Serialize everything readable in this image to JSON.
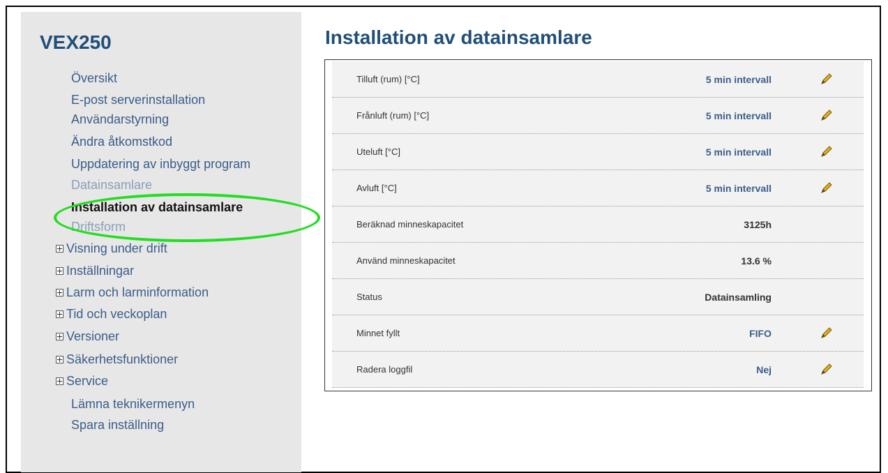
{
  "app": {
    "title": "VEX250"
  },
  "menu": {
    "items": [
      {
        "label": "Översikt"
      },
      {
        "label": "E-post serverinstallation"
      },
      {
        "label": "Användarstyrning"
      },
      {
        "label": "Ändra åtkomstkod"
      },
      {
        "label": "Uppdatering av inbyggt program"
      },
      {
        "label": "Datainsamlare"
      },
      {
        "label": "Installation av datainsamlare"
      },
      {
        "label": "Driftsform"
      },
      {
        "label": "Visning under drift"
      },
      {
        "label": "Inställningar"
      },
      {
        "label": "Larm och larminformation"
      },
      {
        "label": "Tid och veckoplan"
      },
      {
        "label": "Versioner"
      },
      {
        "label": "Säkerhetsfunktioner"
      },
      {
        "label": "Service"
      },
      {
        "label": "Lämna teknikermenyn"
      },
      {
        "label": "Spara inställning"
      }
    ],
    "active_item": "Installation av datainsamlare",
    "highlight_color": "#22dd22"
  },
  "page": {
    "title": "Installation av datainsamlare"
  },
  "settings": {
    "rows": [
      {
        "label": "Tilluft (rum) [°C]",
        "value": "5 min intervall",
        "editable": true
      },
      {
        "label": "Frånluft (rum) [°C]",
        "value": "5 min intervall",
        "editable": true
      },
      {
        "label": "Uteluft [°C]",
        "value": "5 min intervall",
        "editable": true
      },
      {
        "label": "Avluft [°C]",
        "value": "5 min intervall",
        "editable": true
      },
      {
        "label": "Beräknad minneskapacitet",
        "value": "3125h",
        "editable": false
      },
      {
        "label": "Använd minneskapacitet",
        "value": "13.6 %",
        "editable": false
      },
      {
        "label": "Status",
        "value": "Datainsamling",
        "editable": false
      },
      {
        "label": "Minnet fyllt",
        "value": "FIFO",
        "editable": true
      },
      {
        "label": "Radera loggfil",
        "value": "Nej",
        "editable": true
      }
    ],
    "edit_icon": "pencil-icon"
  },
  "colors": {
    "heading": "#1f4e79",
    "link": "#3a5d8a",
    "sidebar_bg": "#e7e7e7",
    "row_bg": "#f2f2f2"
  }
}
